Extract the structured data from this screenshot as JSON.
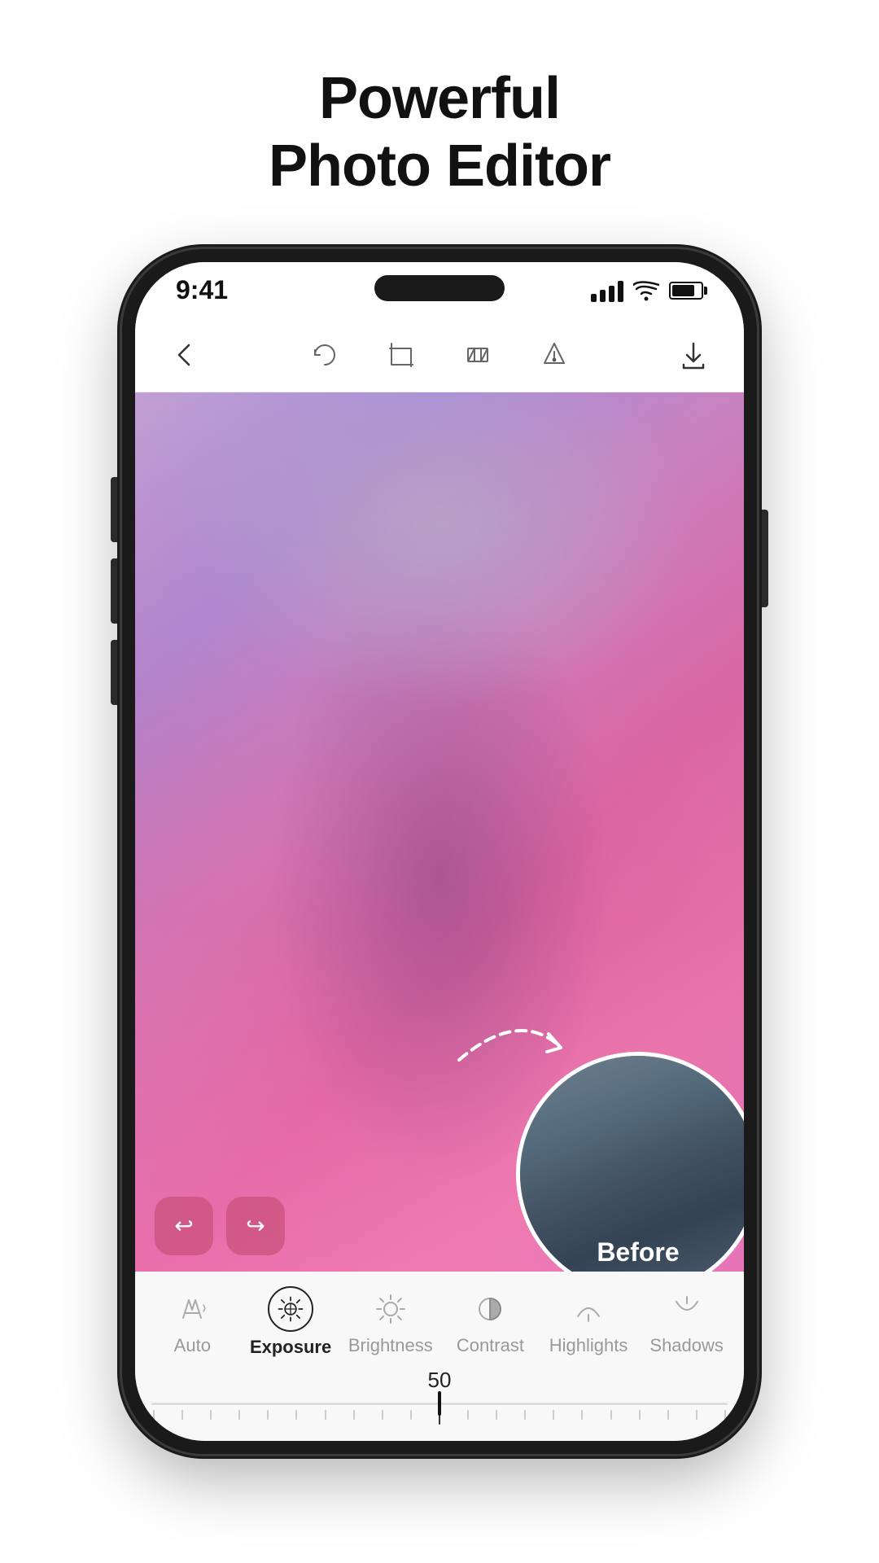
{
  "page": {
    "title_line1": "Powerful",
    "title_line2": "Photo Editor"
  },
  "status_bar": {
    "time": "9:41"
  },
  "toolbar": {
    "back_label": "back",
    "download_label": "download"
  },
  "before_label": "Before",
  "slider": {
    "value": "50"
  },
  "edit_tools": [
    {
      "id": "auto",
      "label": "Auto",
      "active": false
    },
    {
      "id": "exposure",
      "label": "Exposure",
      "active": true
    },
    {
      "id": "brightness",
      "label": "Brightness",
      "active": false
    },
    {
      "id": "contrast",
      "label": "Contrast",
      "active": false
    },
    {
      "id": "highlights",
      "label": "Highlights",
      "active": false
    },
    {
      "id": "shadows",
      "label": "Shadows",
      "active": false
    }
  ],
  "colors": {
    "accent": "#111111",
    "action_btn": "rgba(200,80,120,0.7)",
    "toolbar_icon": "#555555"
  }
}
